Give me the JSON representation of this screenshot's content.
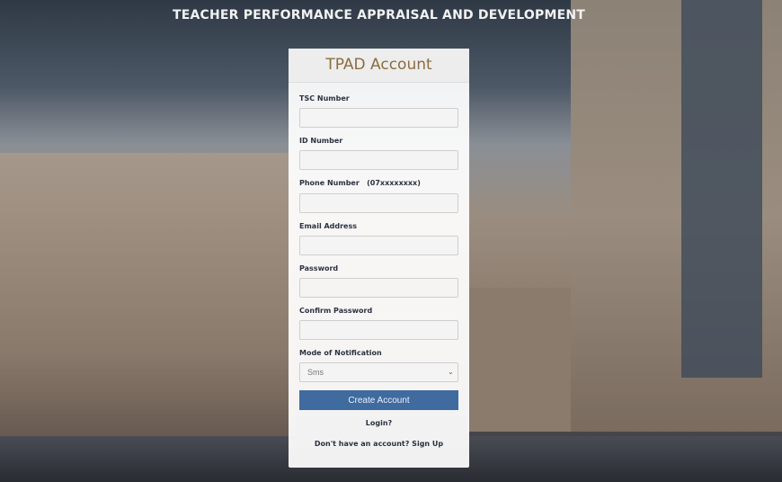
{
  "page": {
    "title": "TEACHER PERFORMANCE APPRAISAL AND DEVELOPMENT"
  },
  "form": {
    "heading": "TPAD Account",
    "fields": [
      {
        "label": "TSC Number",
        "value": ""
      },
      {
        "label": "ID Number",
        "value": ""
      },
      {
        "label": "Phone Number   (07xxxxxxxx)",
        "value": ""
      },
      {
        "label": "Email Address",
        "value": ""
      },
      {
        "label": "Password",
        "value": ""
      },
      {
        "label": "Confirm Password",
        "value": ""
      }
    ],
    "notification": {
      "label": "Mode of Notification",
      "selected": "Sms"
    },
    "submit_label": "Create Account",
    "login_link": "Login?",
    "signup_link": "Don't have an account? Sign Up"
  },
  "colors": {
    "accent": "#3f6b9e",
    "heading": "#8c6d3f"
  }
}
